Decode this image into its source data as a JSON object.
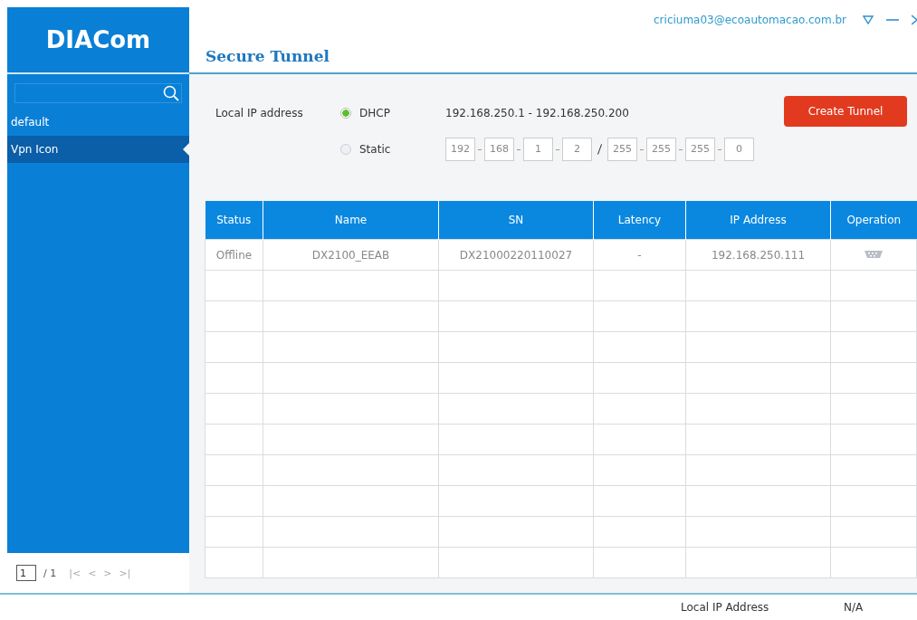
{
  "logo": "DIACom",
  "sidebar": {
    "items": [
      {
        "label": "default",
        "selected": false
      },
      {
        "label": "Vpn Icon",
        "selected": true
      }
    ],
    "pager": {
      "page": "1",
      "total": "/ 1",
      "buttons": [
        "|<",
        "<",
        ">",
        ">|"
      ]
    }
  },
  "header": {
    "account": "criciuma03@ecoautomacao.com.br",
    "title": "Secure Tunnel"
  },
  "local_ip": {
    "label": "Local IP address",
    "options": [
      {
        "label": "DHCP",
        "selected": true,
        "kind": "range",
        "range": "192.168.250.1 - 192.168.250.200"
      },
      {
        "label": "Static",
        "selected": false,
        "kind": "address",
        "ip": [
          "192",
          "168",
          "1",
          "2"
        ],
        "mask": [
          "255",
          "255",
          "255",
          "0"
        ]
      }
    ],
    "button": "Create Tunnel"
  },
  "table": {
    "columns": [
      "Status",
      "Name",
      "SN",
      "Latency",
      "IP Address",
      "Operation"
    ],
    "rows": [
      {
        "status": "Offline",
        "name": "DX2100_EEAB",
        "sn": "DX21000220110027",
        "latency": "-",
        "ip_address": "192.168.250.111"
      }
    ]
  },
  "status_bar": {
    "label": "Local IP Address",
    "value": "N/A"
  }
}
